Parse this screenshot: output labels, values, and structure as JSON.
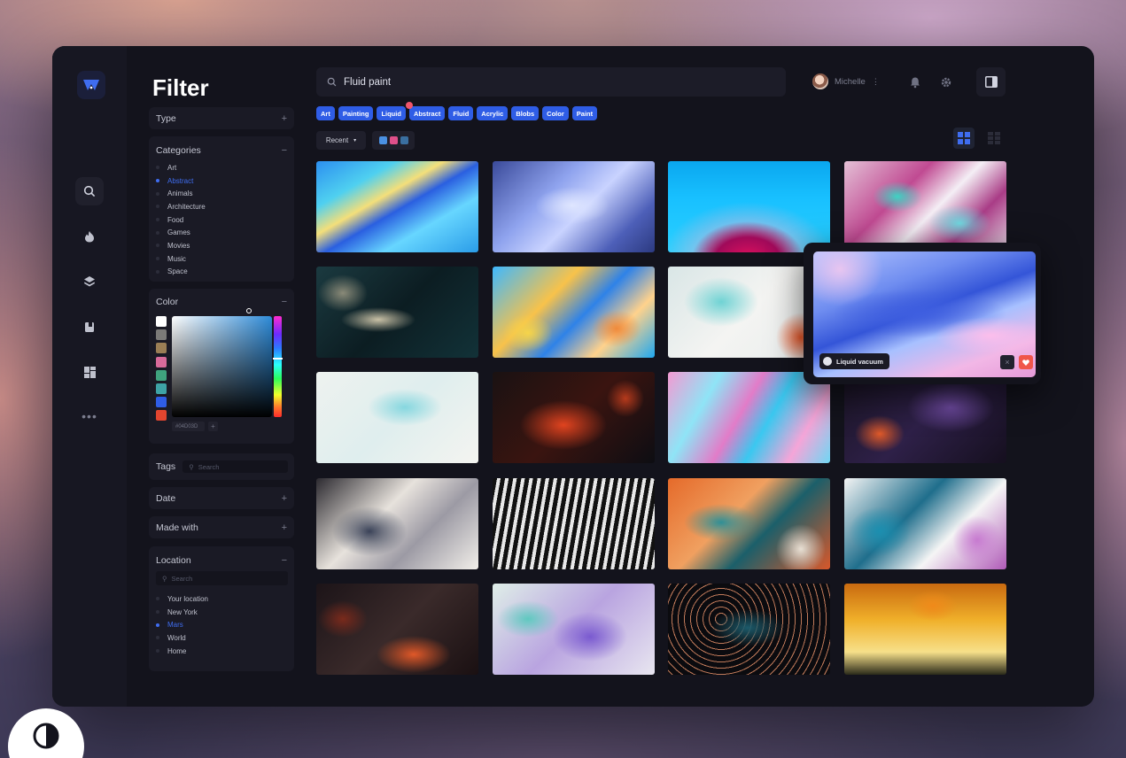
{
  "app": {
    "accent": "#2f5de6"
  },
  "rail": {
    "icons": [
      "logo-icon",
      "search-icon",
      "flame-icon",
      "layers-icon",
      "bookmark-icon",
      "dashboard-icon",
      "more-icon"
    ]
  },
  "filter": {
    "title": "Filter",
    "type_label": "Type",
    "categories_label": "Categories",
    "categories": [
      {
        "label": "Art",
        "selected": false
      },
      {
        "label": "Abstract",
        "selected": true
      },
      {
        "label": "Animals",
        "selected": false
      },
      {
        "label": "Architecture",
        "selected": false
      },
      {
        "label": "Food",
        "selected": false
      },
      {
        "label": "Games",
        "selected": false
      },
      {
        "label": "Movies",
        "selected": false
      },
      {
        "label": "Music",
        "selected": false
      },
      {
        "label": "Space",
        "selected": false
      }
    ],
    "color_label": "Color",
    "swatches": [
      "#ffffff",
      "#7b7a78",
      "#9a7e55",
      "#d86a9a",
      "#3fa37e",
      "#3ea3a6",
      "#2f5de6",
      "#e2452f"
    ],
    "hex_value": "#04D03D",
    "tags_label": "Tags",
    "tags_search_placeholder": "Search",
    "date_label": "Date",
    "made_with_label": "Made with",
    "location_label": "Location",
    "location_search_placeholder": "Search",
    "locations": [
      {
        "label": "Your location",
        "selected": false
      },
      {
        "label": "New York",
        "selected": false
      },
      {
        "label": "Mars",
        "selected": true
      },
      {
        "label": "World",
        "selected": false
      },
      {
        "label": "Home",
        "selected": false
      }
    ]
  },
  "search": {
    "value": "Fluid paint"
  },
  "user": {
    "name": "Michelle"
  },
  "tags": [
    "Art",
    "Painting",
    "Liquid",
    "Abstract",
    "Fluid",
    "Acrylic",
    "Blobs",
    "Color",
    "Paint"
  ],
  "sort": {
    "label": "Recent"
  },
  "color_filter": [
    "#4a90e2",
    "#e0508a",
    "#3a6fa0"
  ],
  "preview": {
    "title": "Liquid vacuum"
  },
  "thumbnails": [
    "fluid-yellow-blue",
    "fluid-periwinkle",
    "fluid-cyan-magenta",
    "fluid-pink-teal",
    "fluid-dark-marble",
    "fluid-yellow-blue-orange",
    "fluid-teal-cells",
    "fluid-blue-pink-swirl",
    "fluid-pale-cyan",
    "fluid-red-lava",
    "fluid-pink-cyan",
    "fluid-purple-dark",
    "fluid-smoke-gray",
    "fluid-bw-drip",
    "fluid-orange-teal",
    "fluid-blue-cells",
    "fluid-red-cells",
    "fluid-lavender-teal",
    "fluid-black-copper",
    "fluid-gold-drip"
  ]
}
